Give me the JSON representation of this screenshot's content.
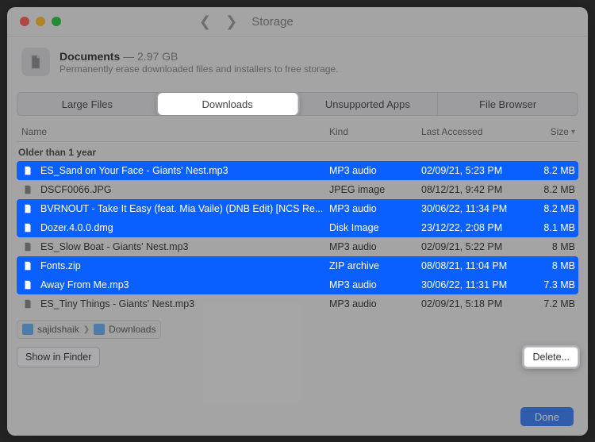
{
  "titlebar": {
    "title": "Storage"
  },
  "header": {
    "title": "Documents",
    "size": "2.97 GB",
    "subtitle": "Permanently erase downloaded files and installers to free storage."
  },
  "tabs": [
    {
      "label": "Large Files",
      "active": false
    },
    {
      "label": "Downloads",
      "active": true
    },
    {
      "label": "Unsupported Apps",
      "active": false
    },
    {
      "label": "File Browser",
      "active": false
    }
  ],
  "columns": {
    "name": "Name",
    "kind": "Kind",
    "last": "Last Accessed",
    "size": "Size"
  },
  "section_label": "Older than 1 year",
  "rows": [
    {
      "selected": true,
      "icon": "audio",
      "name": "ES_Sand on Your Face - Giants' Nest.mp3",
      "kind": "MP3 audio",
      "last": "02/09/21, 5:23 PM",
      "size": "8.2 MB"
    },
    {
      "selected": false,
      "icon": "image",
      "name": "DSCF0066.JPG",
      "kind": "JPEG image",
      "last": "08/12/21, 9:42 PM",
      "size": "8.2 MB"
    },
    {
      "selected": true,
      "icon": "audio",
      "name": "BVRNOUT - Take It Easy (feat. Mia Vaile) (DNB Edit) [NCS Re...",
      "kind": "MP3 audio",
      "last": "30/06/22, 11:34 PM",
      "size": "8.2 MB"
    },
    {
      "selected": true,
      "icon": "disk",
      "name": "Dozer.4.0.0.dmg",
      "kind": "Disk Image",
      "last": "23/12/22, 2:08 PM",
      "size": "8.1 MB"
    },
    {
      "selected": false,
      "icon": "audio",
      "name": "ES_Slow Boat - Giants' Nest.mp3",
      "kind": "MP3 audio",
      "last": "02/09/21, 5:22 PM",
      "size": "8 MB"
    },
    {
      "selected": true,
      "icon": "zip",
      "name": "Fonts.zip",
      "kind": "ZIP archive",
      "last": "08/08/21, 11:04 PM",
      "size": "8 MB"
    },
    {
      "selected": true,
      "icon": "audio",
      "name": "Away From Me.mp3",
      "kind": "MP3 audio",
      "last": "30/06/22, 11:31 PM",
      "size": "7.3 MB"
    },
    {
      "selected": false,
      "icon": "audio",
      "name": "ES_Tiny Things - Giants' Nest.mp3",
      "kind": "MP3 audio",
      "last": "02/09/21, 5:18 PM",
      "size": "7.2 MB"
    }
  ],
  "path": {
    "root": "sajidshaik",
    "current": "Downloads"
  },
  "buttons": {
    "show": "Show in Finder",
    "delete": "Delete...",
    "done": "Done"
  }
}
